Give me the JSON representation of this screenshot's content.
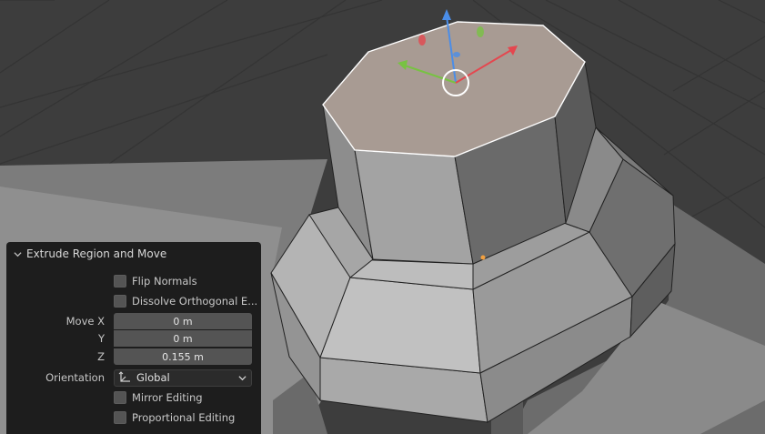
{
  "redo_panel": {
    "title": "Extrude Region and Move",
    "flip_normals": {
      "label": "Flip Normals",
      "checked": false
    },
    "dissolve_orthogonal": {
      "label": "Dissolve Orthogonal E...",
      "checked": false
    },
    "move": {
      "x_label": "Move X",
      "x_value": "0 m",
      "y_label": "Y",
      "y_value": "0 m",
      "z_label": "Z",
      "z_value": "0.155 m"
    },
    "orientation": {
      "label": "Orientation",
      "value": "Global"
    },
    "mirror_editing": {
      "label": "Mirror Editing",
      "checked": false
    },
    "proportional_editing": {
      "label": "Proportional Editing",
      "checked": false
    }
  },
  "colors": {
    "panel_bg": "#1d1d1d",
    "viewport_bg": "#3d3d3d",
    "selected_face": "#a89b93",
    "gizmo_x": "#e4474f",
    "gizmo_y": "#78c243",
    "gizmo_z": "#4a8de8"
  },
  "icons": [
    "chevron-down-icon",
    "axis-orientation-icon",
    "dropdown-chevron-icon"
  ]
}
